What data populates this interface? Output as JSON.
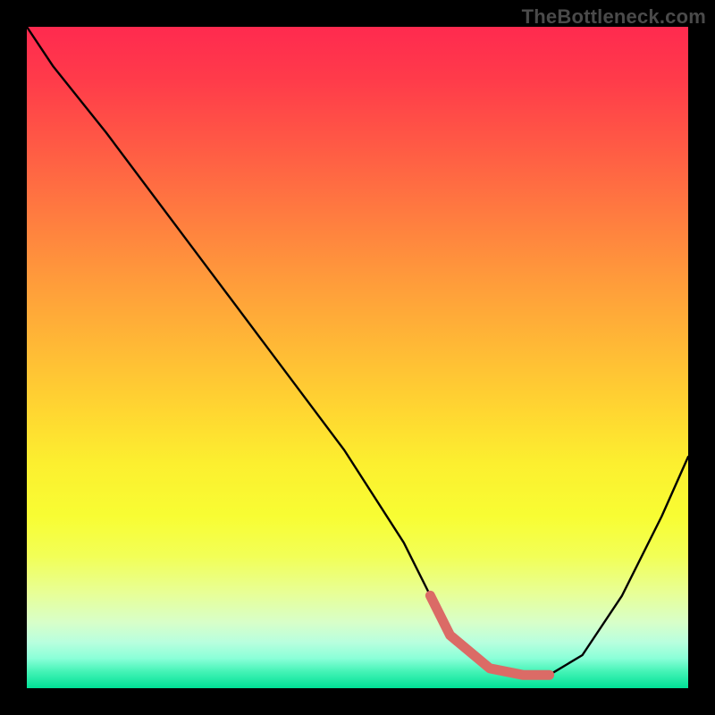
{
  "watermark": "TheBottleneck.com",
  "chart_data": {
    "type": "line",
    "title": "",
    "xlabel": "",
    "ylabel": "",
    "xlim": [
      0,
      100
    ],
    "ylim": [
      0,
      100
    ],
    "axes_visible": false,
    "grid": false,
    "background_gradient": {
      "top": "#ff2a4f",
      "middle": "#ffe431",
      "bottom": "#00e196"
    },
    "series": [
      {
        "name": "bottleneck-curve",
        "x": [
          0,
          4,
          12,
          24,
          36,
          48,
          57,
          61,
          64,
          70,
          75,
          79,
          84,
          90,
          96,
          100
        ],
        "y": [
          100,
          94,
          84,
          68,
          52,
          36,
          22,
          14,
          8,
          3,
          2,
          2,
          5,
          14,
          26,
          35
        ],
        "stroke": "#000000"
      }
    ],
    "valley_highlight": {
      "color": "#db6b66",
      "x": [
        61,
        64,
        70,
        75,
        79
      ],
      "y": [
        14,
        8,
        3,
        2,
        2
      ]
    }
  }
}
